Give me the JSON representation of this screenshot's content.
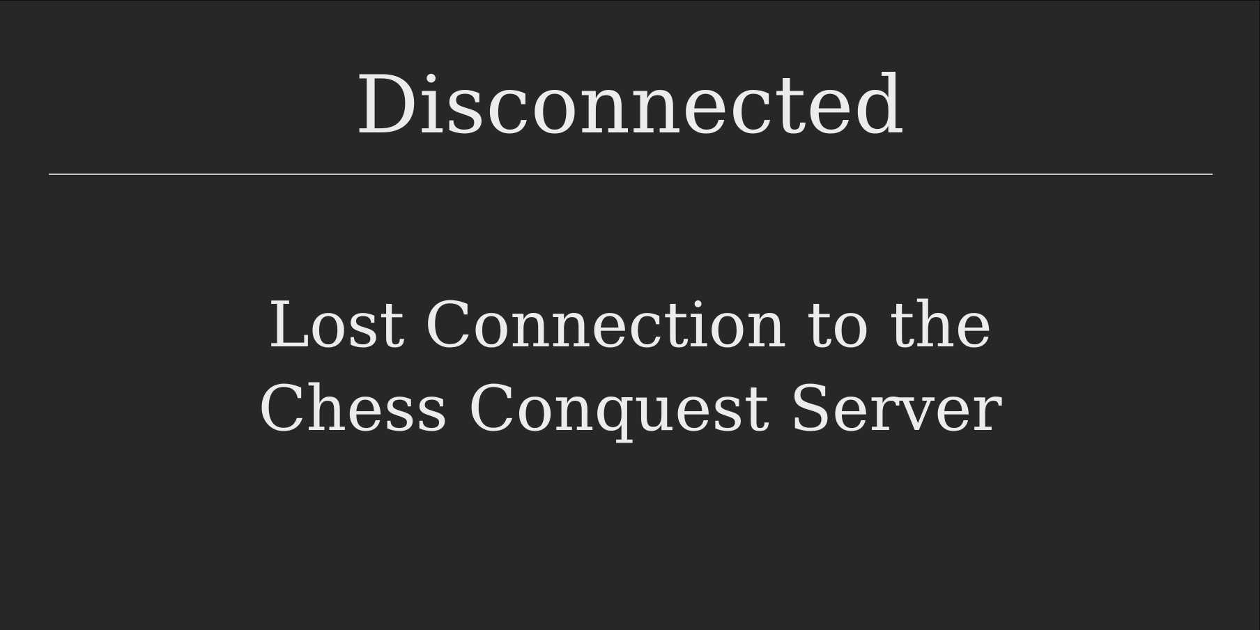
{
  "dialog": {
    "title": "Disconnected",
    "message_lines": [
      "Lost Connection to the",
      "Chess Conquest Server"
    ]
  },
  "colors": {
    "background": "#272727",
    "text": "#ececec",
    "divider": "#c9c9c9"
  }
}
